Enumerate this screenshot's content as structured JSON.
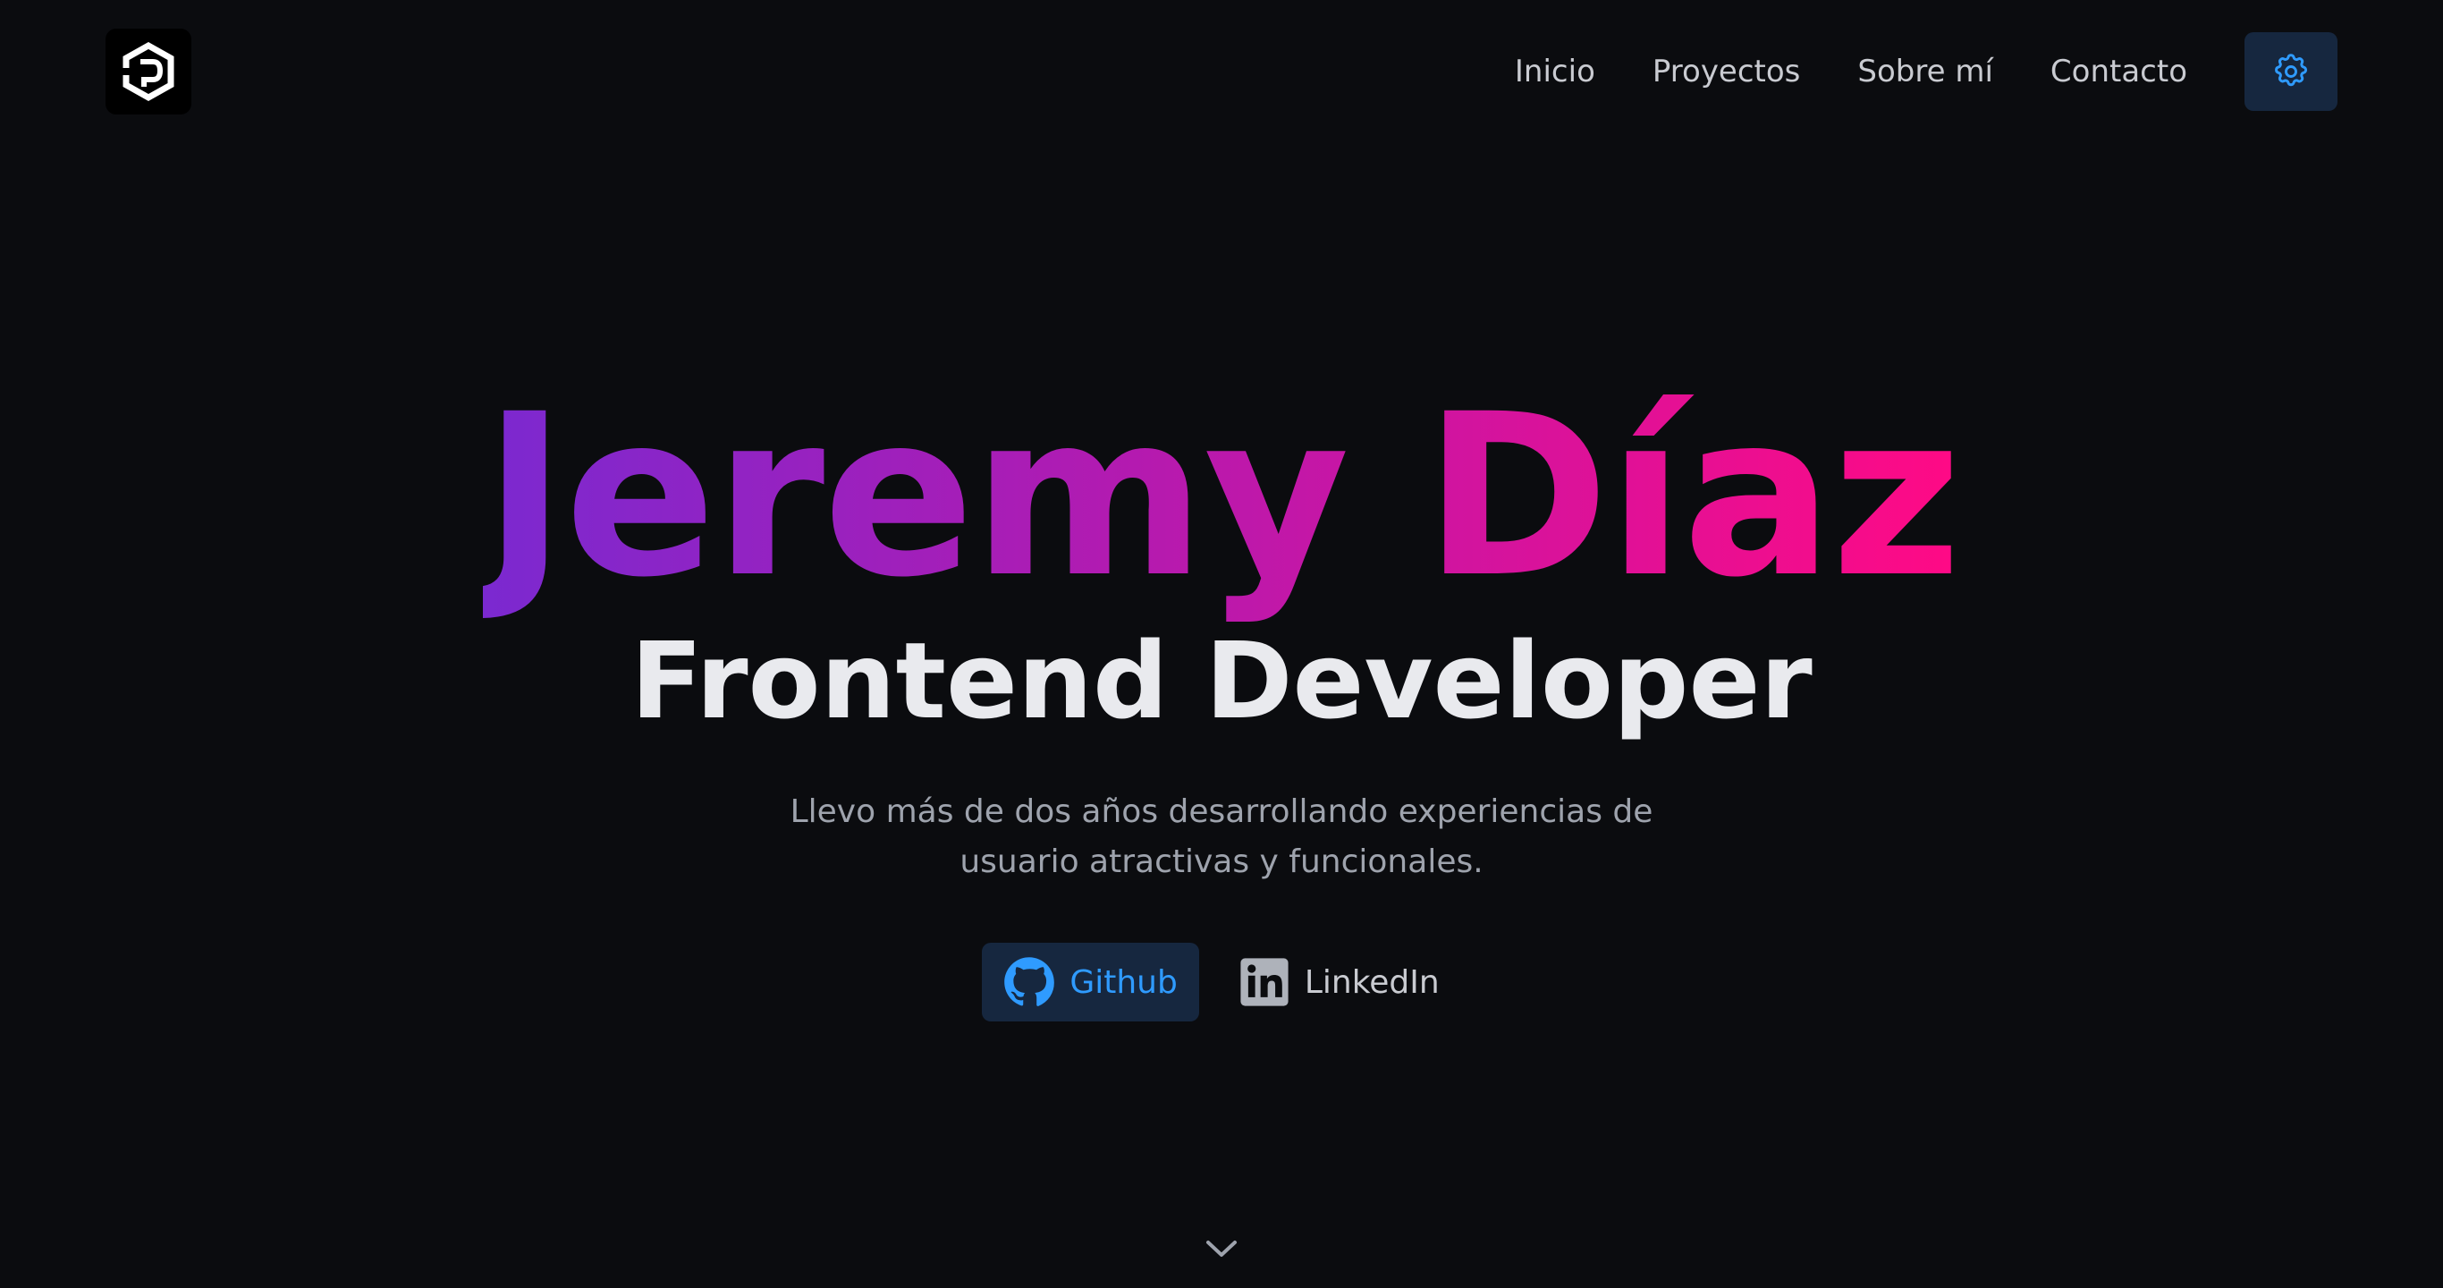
{
  "header": {
    "logo_icon": "hexagon-d-logo-icon",
    "nav": [
      {
        "label": "Inicio"
      },
      {
        "label": "Proyectos"
      },
      {
        "label": "Sobre mí"
      },
      {
        "label": "Contacto"
      }
    ],
    "settings_icon": "gear-icon"
  },
  "hero": {
    "name": "Jeremy Díaz",
    "role": "Frontend Developer",
    "description": "Llevo más de dos años desarrollando experiencias de usuario atractivas y funcionales.",
    "links": {
      "github": {
        "label": "Github",
        "icon": "github-icon"
      },
      "linkedin": {
        "label": "LinkedIn",
        "icon": "linkedin-icon"
      }
    },
    "scroll_icon": "chevron-down-icon"
  },
  "colors": {
    "background": "#0b0c0f",
    "accent": "#2f9bff",
    "button_bg": "#16273f",
    "gradient_start": "#7b29d0",
    "gradient_end": "#ff0a85",
    "text_primary": "#e9eaee",
    "text_muted": "#9ea3ad"
  }
}
